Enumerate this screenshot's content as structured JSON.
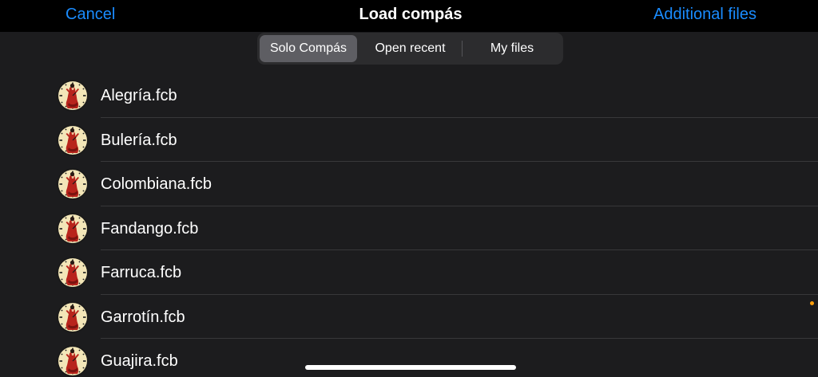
{
  "navbar": {
    "cancel_label": "Cancel",
    "title": "Load compás",
    "additional_label": "Additional files"
  },
  "segments": [
    {
      "label": "Solo Compás",
      "selected": true
    },
    {
      "label": "Open recent",
      "selected": false
    },
    {
      "label": "My files",
      "selected": false
    }
  ],
  "files": [
    {
      "name": "Alegría.fcb",
      "icon": "flamenco-dancer-clock-icon"
    },
    {
      "name": "Bulería.fcb",
      "icon": "flamenco-dancer-clock-icon"
    },
    {
      "name": "Colombiana.fcb",
      "icon": "flamenco-dancer-clock-icon"
    },
    {
      "name": "Fandango.fcb",
      "icon": "flamenco-dancer-clock-icon"
    },
    {
      "name": "Farruca.fcb",
      "icon": "flamenco-dancer-clock-icon"
    },
    {
      "name": "Garrotín.fcb",
      "icon": "flamenco-dancer-clock-icon"
    },
    {
      "name": "Guajira.fcb",
      "icon": "flamenco-dancer-clock-icon"
    }
  ],
  "colors": {
    "accent": "#1a8cff",
    "background": "#1c1c1e",
    "navbar": "#000000",
    "segment_bg": "#2c2c2e",
    "segment_selected": "#5e5e63",
    "indicator_dot": "#ff9f0a"
  }
}
